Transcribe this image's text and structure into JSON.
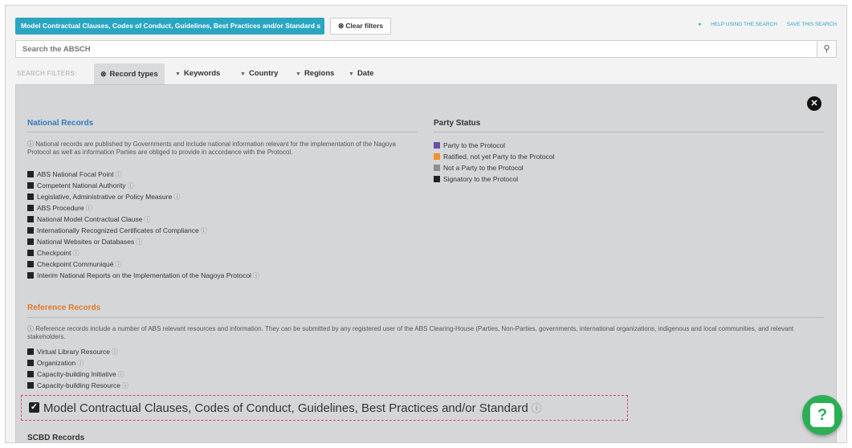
{
  "topbar": {
    "active_filter_chip": "Model Contractual Clauses, Codes of Conduct, Guidelines, Best Practices and/or Standard s",
    "clear_filters_label": "Clear filters",
    "help_link": "HELP USING THE SEARCH",
    "save_link": "SAVE THIS SEARCH"
  },
  "search": {
    "placeholder": "Search the ABSCH"
  },
  "filters": {
    "label": "SEARCH FILTERS:",
    "tabs": [
      {
        "label": "Record types",
        "active": true
      },
      {
        "label": "Keywords"
      },
      {
        "label": "Country"
      },
      {
        "label": "Regions"
      },
      {
        "label": "Date"
      }
    ]
  },
  "national": {
    "title": "National Records",
    "description": "National records are published by Governments and include national information relevant for the implementation of the Nagoya Protocol as well as information Parties are obliged to provide in accordance with the Protocol.",
    "items": [
      "ABS National Focal Point",
      "Competent National Authority",
      "Legislative, Administrative or Policy Measure",
      "ABS Procedure",
      "National Model Contractual Clause",
      "Internationally Recognized Certificates of Compliance",
      "National Websites or Databases",
      "Checkpoint",
      "Checkpoint Communiqué",
      "Interim National Reports on the Implementation of the Nagoya Protocol"
    ]
  },
  "party_status": {
    "title": "Party Status",
    "items": [
      {
        "label": "Party to the Protocol",
        "color": "#6a4fa3"
      },
      {
        "label": "Ratified, not yet Party to the Protocol",
        "color": "#f0922b"
      },
      {
        "label": "Not a Party to the Protocol",
        "color": "#8d8e90"
      },
      {
        "label": "Signatory to the Protocol",
        "color": "#222222"
      }
    ]
  },
  "reference": {
    "title": "Reference Records",
    "description": "Reference records include a number of ABS relevant resources and information. They can be submitted by any registered user of the ABS Clearing-House (Parties, Non-Parties, governments, international organizations, indigenous and local communities, and relevant stakeholders.",
    "items": [
      "Virtual Library Resource",
      "Organization",
      "Capacity-building Initiative",
      "Capacity-building Resource"
    ]
  },
  "highlighted": {
    "label": "Model Contractual Clauses, Codes of Conduct, Guidelines, Best Practices and/or Standard",
    "checked": true
  },
  "scbd": {
    "title": "SCBD Records"
  }
}
